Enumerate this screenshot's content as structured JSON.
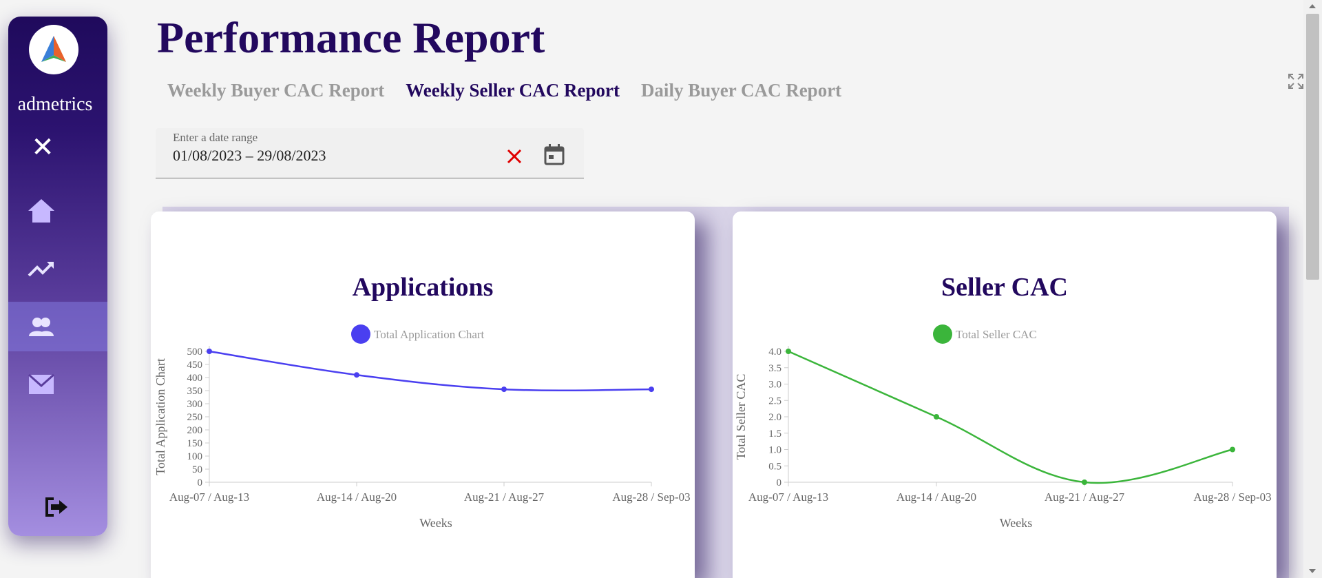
{
  "sidebar": {
    "brand": "admetrics",
    "close_icon": "close-icon",
    "items": [
      {
        "icon": "home-icon",
        "active": false
      },
      {
        "icon": "trending-up-icon",
        "active": false
      },
      {
        "icon": "users-icon",
        "active": true
      },
      {
        "icon": "mail-icon",
        "active": false
      }
    ],
    "logout_icon": "logout-icon"
  },
  "header": {
    "title": "Performance Report",
    "tabs": [
      {
        "label": "Weekly Buyer CAC Report",
        "active": false
      },
      {
        "label": "Weekly Seller CAC Report",
        "active": true
      },
      {
        "label": "Daily Buyer CAC Report",
        "active": false
      }
    ]
  },
  "date_range": {
    "label": "Enter a date range",
    "value": "01/08/2023 – 29/08/2023"
  },
  "colors": {
    "title": "#22085e",
    "applications_series": "#4a3ff0",
    "seller_series": "#3bb53b",
    "clear_icon": "#e00000"
  },
  "chart_data": [
    {
      "type": "line",
      "title": "Applications",
      "legend": "Total Application Chart",
      "legend_placement": "top",
      "xlabel": "Weeks",
      "ylabel": "Total Application Chart",
      "categories": [
        "Aug-07 / Aug-13",
        "Aug-14 / Aug-20",
        "Aug-21 / Aug-27",
        "Aug-28 / Sep-03"
      ],
      "series": [
        {
          "name": "Total Application Chart",
          "values": [
            500,
            410,
            355,
            355
          ]
        }
      ],
      "yticks": [
        "0",
        "50",
        "100",
        "150",
        "200",
        "250",
        "300",
        "350",
        "400",
        "450",
        "500"
      ],
      "ylim": [
        0,
        500
      ],
      "color": "#4a3ff0"
    },
    {
      "type": "line",
      "title": "Seller CAC",
      "legend": "Total Seller CAC",
      "legend_placement": "top",
      "xlabel": "Weeks",
      "ylabel": "Total Seller CAC",
      "categories": [
        "Aug-07 / Aug-13",
        "Aug-14 / Aug-20",
        "Aug-21 / Aug-27",
        "Aug-28 / Sep-03"
      ],
      "series": [
        {
          "name": "Total Seller CAC",
          "values": [
            4.0,
            2.0,
            0.0,
            1.0
          ]
        }
      ],
      "yticks": [
        "0",
        "0.5",
        "1.0",
        "1.5",
        "2.0",
        "2.5",
        "3.0",
        "3.5",
        "4.0"
      ],
      "ylim": [
        0,
        4
      ],
      "color": "#3bb53b"
    }
  ]
}
